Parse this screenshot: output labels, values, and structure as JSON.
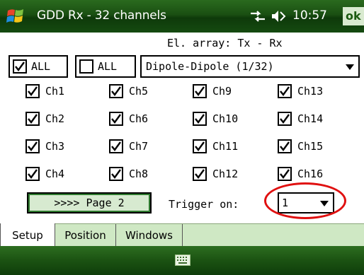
{
  "titlebar": {
    "title": "GDD Rx - 32 channels",
    "time": "10:57",
    "ok_label": "ok"
  },
  "config": {
    "el_array_label": "El. array: Tx - Rx",
    "all_checked_label": "ALL",
    "all_unchecked_label": "ALL",
    "array_type": "Dipole-Dipole (1/32)"
  },
  "channels": [
    {
      "label": "Ch1",
      "checked": true
    },
    {
      "label": "Ch2",
      "checked": true
    },
    {
      "label": "Ch3",
      "checked": true
    },
    {
      "label": "Ch4",
      "checked": true
    },
    {
      "label": "Ch5",
      "checked": true
    },
    {
      "label": "Ch6",
      "checked": true
    },
    {
      "label": "Ch7",
      "checked": true
    },
    {
      "label": "Ch8",
      "checked": true
    },
    {
      "label": "Ch9",
      "checked": true
    },
    {
      "label": "Ch10",
      "checked": true
    },
    {
      "label": "Ch11",
      "checked": true
    },
    {
      "label": "Ch12",
      "checked": true
    },
    {
      "label": "Ch13",
      "checked": true
    },
    {
      "label": "Ch14",
      "checked": true
    },
    {
      "label": "Ch15",
      "checked": true
    },
    {
      "label": "Ch16",
      "checked": true
    }
  ],
  "controls": {
    "page_button_label": ">>>> Page 2",
    "trigger_label": "Trigger on:",
    "trigger_value": "1"
  },
  "tabs": [
    {
      "label": "Setup",
      "active": true
    },
    {
      "label": "Position",
      "active": false
    },
    {
      "label": "Windows",
      "active": false
    }
  ],
  "colors": {
    "titlebar_green": "#1a4f12",
    "tab_green": "#cfe8c4",
    "button_green": "#d7ead0",
    "highlight_red": "#e01010"
  },
  "icons": [
    "windows-start-icon",
    "signal-icon",
    "volume-icon",
    "keyboard-icon",
    "chevron-down-icon"
  ]
}
